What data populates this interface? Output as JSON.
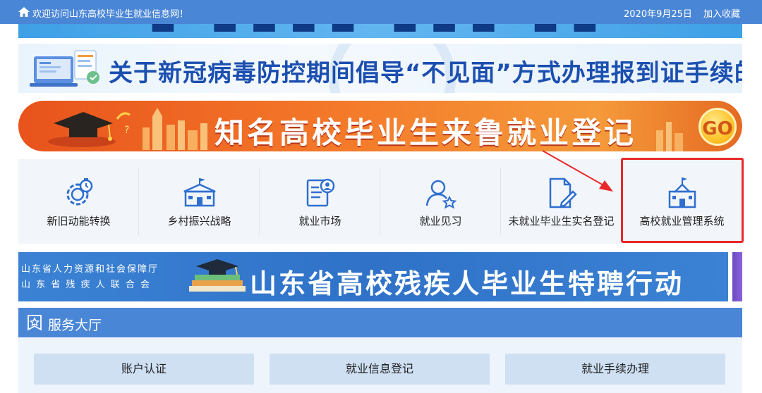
{
  "topbar": {
    "home_icon": "home-icon",
    "welcome": "欢迎访问山东高校毕业生就业信息网！",
    "date": "2020年9月25日",
    "favorite": "加入收藏"
  },
  "banners": {
    "covid": "关于新冠病毒防控期间倡导“不见面”方式办理报到证手续的倡议书",
    "famous": "知名高校毕业生来鲁就业登记",
    "famous_go": "GO",
    "disabled_org_1": "山东省人力资源和社会保障厅",
    "disabled_org_2": "山 东 省 残 疾 人 联 合 会",
    "disabled_title": "山东省高校残疾人毕业生特聘行动"
  },
  "nav": {
    "items": [
      {
        "label": "新旧动能转换",
        "icon": "gear-clock-icon"
      },
      {
        "label": "乡村振兴战略",
        "icon": "school-building-icon"
      },
      {
        "label": "就业市场",
        "icon": "resume-icon"
      },
      {
        "label": "就业见习",
        "icon": "user-star-icon"
      },
      {
        "label": "未就业毕业生实名登记",
        "icon": "document-edit-icon"
      },
      {
        "label": "高校就业管理系统",
        "icon": "school-flag-icon"
      }
    ]
  },
  "service": {
    "title": "服务大厅",
    "buttons": [
      "账户认证",
      "就业信息登记",
      "就业手续办理"
    ]
  },
  "colors": {
    "primary": "#4a86d6",
    "highlight": "#e8282a",
    "orange": "#f47a2a"
  }
}
